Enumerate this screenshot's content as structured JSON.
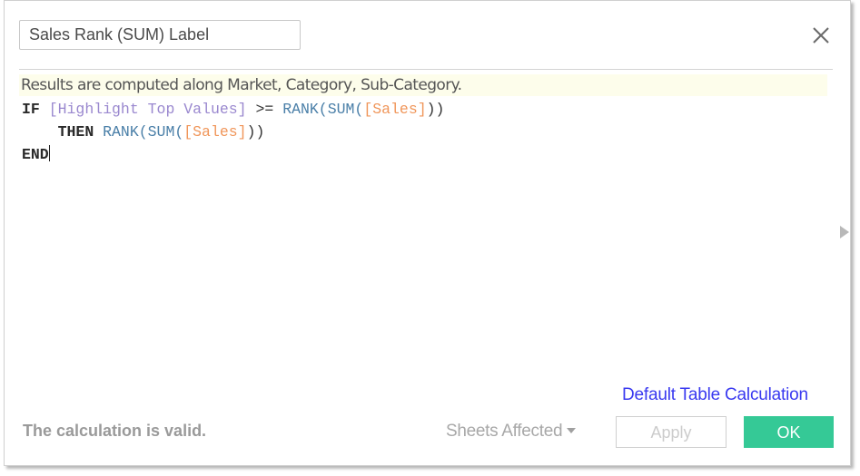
{
  "dialog": {
    "calculation_name": "Sales Rank (SUM) Label",
    "close_icon": "close-x-icon",
    "info_message": "Results are computed along Market, Category, Sub-Category.",
    "formula": {
      "line1": {
        "kw_if": "IF",
        "field_highlight": "[Highlight Top Values]",
        "op": ">=",
        "fn_rank": "RANK(",
        "fn_sum": "SUM(",
        "field_sales": "[Sales]",
        "close": "))"
      },
      "line2": {
        "kw_then": "THEN",
        "fn_rank": "RANK(",
        "fn_sum": "SUM(",
        "field_sales": "[Sales]",
        "close": "))"
      },
      "line3": {
        "kw_end": "END"
      }
    },
    "expand_icon": "triangle-right-icon",
    "default_table_calc_link": "Default Table Calculation",
    "status_text": "The calculation is valid.",
    "sheets_affected_label": "Sheets Affected",
    "apply_label": "Apply",
    "ok_label": "OK"
  },
  "colors": {
    "ok_button": "#35c996",
    "link": "#3a3af0",
    "info_bar_bg": "#fdfdeb",
    "field_ref": "#9a88cf",
    "function": "#4a7fa8",
    "measure_ref": "#f0965a"
  }
}
